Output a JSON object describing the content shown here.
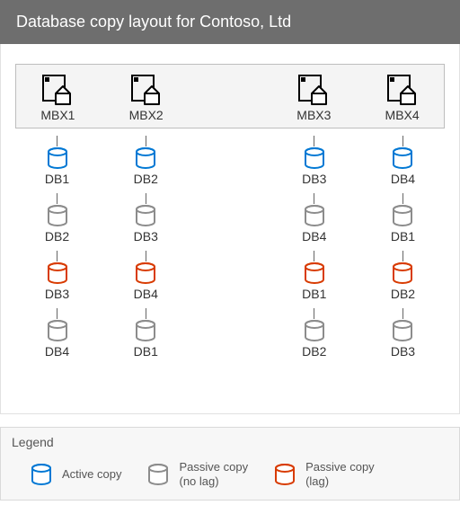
{
  "title": "Database copy layout for Contoso, Ltd",
  "colors": {
    "active": "#0078d4",
    "passive_nolag": "#8c8c8c",
    "passive_lag": "#d83b01"
  },
  "servers": [
    {
      "name": "MBX1"
    },
    {
      "name": "MBX2"
    },
    {
      "name": "MBX3"
    },
    {
      "name": "MBX4"
    }
  ],
  "db_columns": [
    {
      "server": "MBX1",
      "copies": [
        {
          "label": "DB1",
          "role": "active"
        },
        {
          "label": "DB2",
          "role": "passive_nolag"
        },
        {
          "label": "DB3",
          "role": "passive_lag"
        },
        {
          "label": "DB4",
          "role": "passive_nolag"
        }
      ]
    },
    {
      "server": "MBX2",
      "copies": [
        {
          "label": "DB2",
          "role": "active"
        },
        {
          "label": "DB3",
          "role": "passive_nolag"
        },
        {
          "label": "DB4",
          "role": "passive_lag"
        },
        {
          "label": "DB1",
          "role": "passive_nolag"
        }
      ]
    },
    {
      "server": "MBX3",
      "copies": [
        {
          "label": "DB3",
          "role": "active"
        },
        {
          "label": "DB4",
          "role": "passive_nolag"
        },
        {
          "label": "DB1",
          "role": "passive_lag"
        },
        {
          "label": "DB2",
          "role": "passive_nolag"
        }
      ]
    },
    {
      "server": "MBX4",
      "copies": [
        {
          "label": "DB4",
          "role": "active"
        },
        {
          "label": "DB1",
          "role": "passive_nolag"
        },
        {
          "label": "DB2",
          "role": "passive_lag"
        },
        {
          "label": "DB3",
          "role": "passive_nolag"
        }
      ]
    }
  ],
  "legend": {
    "title": "Legend",
    "items": [
      {
        "role": "active",
        "label": "Active copy",
        "sub": ""
      },
      {
        "role": "passive_nolag",
        "label": "Passive copy",
        "sub": "(no lag)"
      },
      {
        "role": "passive_lag",
        "label": "Passive copy",
        "sub": "(lag)"
      }
    ]
  }
}
